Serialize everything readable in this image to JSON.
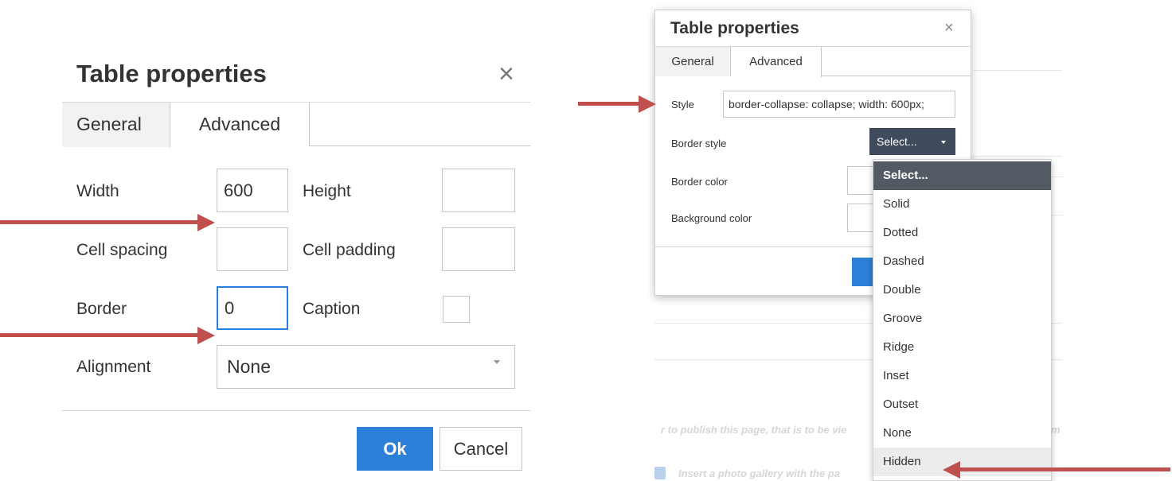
{
  "left_dialog": {
    "title": "Table properties",
    "close_glyph": "×",
    "tabs": [
      "General",
      "Advanced"
    ],
    "active_tab": "General",
    "fields": {
      "width_label": "Width",
      "width_value": "600",
      "height_label": "Height",
      "height_value": "",
      "cell_spacing_label": "Cell spacing",
      "cell_spacing_value": "",
      "cell_padding_label": "Cell padding",
      "cell_padding_value": "",
      "border_label": "Border",
      "border_value": "0",
      "caption_label": "Caption",
      "alignment_label": "Alignment",
      "alignment_value": "None"
    },
    "ok_label": "Ok",
    "cancel_label": "Cancel"
  },
  "right_dialog": {
    "title": "Table properties",
    "close_glyph": "×",
    "tabs": [
      "General",
      "Advanced"
    ],
    "active_tab": "Advanced",
    "style_label": "Style",
    "style_value": "border-collapse: collapse; width: 600px;",
    "border_style_label": "Border style",
    "border_style_selected": "Select...",
    "border_color_label": "Border color",
    "background_color_label": "Background color",
    "border_style_options": [
      "Select...",
      "Solid",
      "Dotted",
      "Dashed",
      "Double",
      "Groove",
      "Ridge",
      "Inset",
      "Outset",
      "None",
      "Hidden"
    ],
    "highlighted_option": "Hidden"
  },
  "background_page": {
    "text_line_1": "r to publish this page, that is to be vie",
    "text_line_1_end": "m",
    "text_line_2": "Insert a photo gallery with the pa"
  },
  "colors": {
    "arrow": "#c0504d",
    "primary_button": "#2d80d8",
    "focus_border": "#2b7de0",
    "select_button": "#3f4a5c",
    "dropdown_selected": "#545a63"
  },
  "icons": [
    "close-icon",
    "chevron-down-icon",
    "annotation-arrow"
  ]
}
